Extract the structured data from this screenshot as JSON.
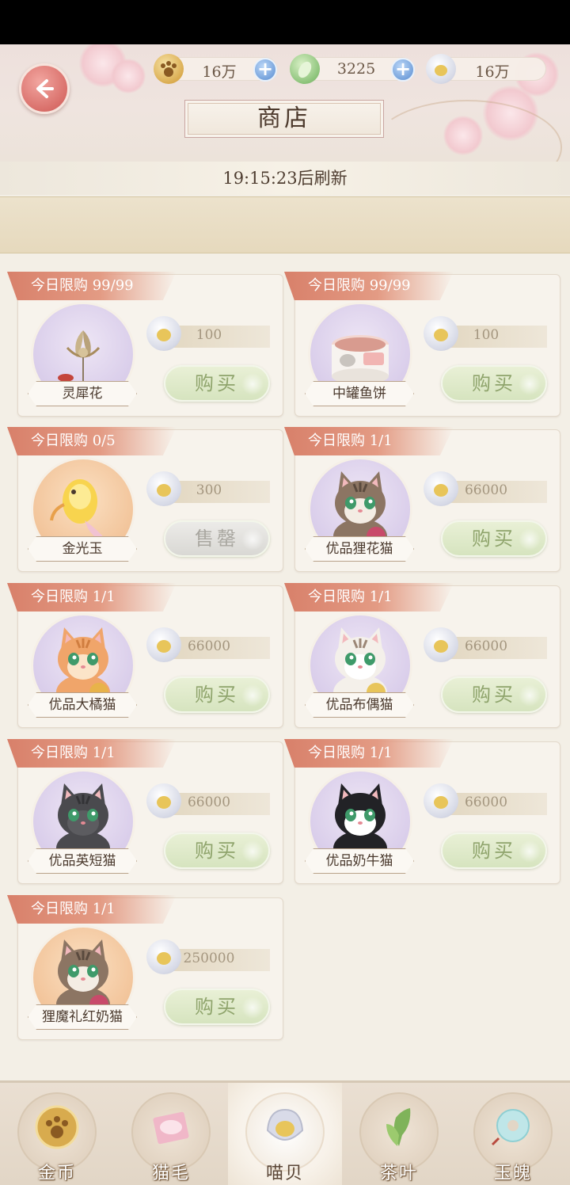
{
  "header": {
    "title": "商店",
    "currencies": [
      {
        "icon": "paw-coin-icon",
        "value": "16万",
        "has_plus": true
      },
      {
        "icon": "jade-leaf-icon",
        "value": "3225",
        "has_plus": true
      },
      {
        "icon": "shell-icon",
        "value": "16万",
        "has_plus": false
      }
    ]
  },
  "refresh_text": "19:15:23后刷新",
  "items": [
    {
      "limit": "今日限购 99/99",
      "name": "灵犀花",
      "price": "100",
      "button": "购买",
      "sold_out": false,
      "art": "lotus-hairpin",
      "bg": "purple"
    },
    {
      "limit": "今日限购 99/99",
      "name": "中罐鱼饼",
      "price": "100",
      "button": "购买",
      "sold_out": false,
      "art": "cat-food-can",
      "bg": "purple"
    },
    {
      "limit": "今日限购 0/5",
      "name": "金光玉",
      "price": "300",
      "button": "售罄",
      "sold_out": true,
      "art": "golden-fish",
      "bg": "orange"
    },
    {
      "limit": "今日限购 1/1",
      "name": "优品狸花猫",
      "price": "66000",
      "button": "购买",
      "sold_out": false,
      "art": "tabby-cat",
      "bg": "purple"
    },
    {
      "limit": "今日限购 1/1",
      "name": "优品大橘猫",
      "price": "66000",
      "button": "购买",
      "sold_out": false,
      "art": "orange-cat",
      "bg": "purple"
    },
    {
      "limit": "今日限购 1/1",
      "name": "优品布偶猫",
      "price": "66000",
      "button": "购买",
      "sold_out": false,
      "art": "ragdoll-cat",
      "bg": "purple"
    },
    {
      "limit": "今日限购 1/1",
      "name": "优品英短猫",
      "price": "66000",
      "button": "购买",
      "sold_out": false,
      "art": "british-shorthair-cat",
      "bg": "purple"
    },
    {
      "limit": "今日限购 1/1",
      "name": "优品奶牛猫",
      "price": "66000",
      "button": "购买",
      "sold_out": false,
      "art": "tuxedo-cat",
      "bg": "purple"
    },
    {
      "limit": "今日限购 1/1",
      "name": "狸魔礼红奶猫",
      "price": "250000",
      "button": "购买",
      "sold_out": false,
      "art": "tabby-kitten",
      "bg": "orange"
    }
  ],
  "nav": [
    {
      "label": "金币",
      "icon": "paw-coin-icon",
      "active": false
    },
    {
      "label": "猫毛",
      "icon": "cat-fur-icon",
      "active": false
    },
    {
      "label": "喵贝",
      "icon": "shell-icon",
      "active": true
    },
    {
      "label": "茶叶",
      "icon": "tea-leaf-icon",
      "active": false
    },
    {
      "label": "玉魄",
      "icon": "jade-ring-icon",
      "active": false
    }
  ],
  "colors": {
    "tag": "#d8806a",
    "buy_green": "#8fa46c",
    "circle_purple": "#d9cdea",
    "circle_orange": "#f2c49a"
  }
}
